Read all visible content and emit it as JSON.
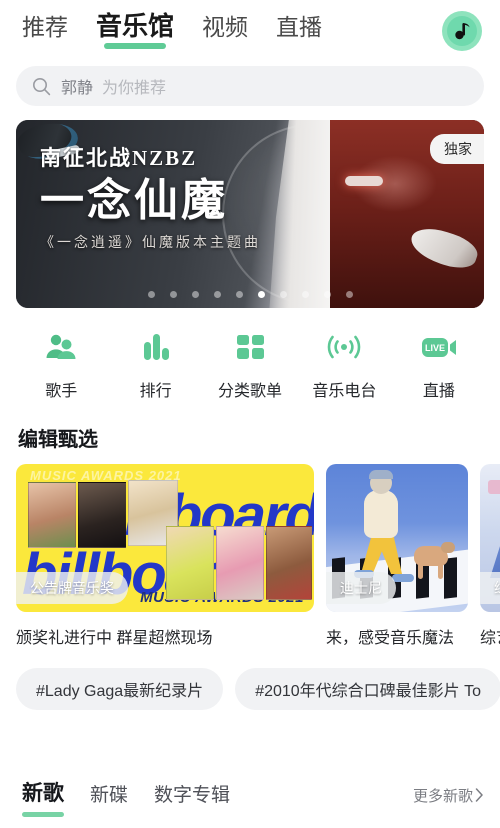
{
  "header": {
    "tabs": [
      {
        "label": "推荐",
        "active": false
      },
      {
        "label": "音乐馆",
        "active": true
      },
      {
        "label": "视频",
        "active": false
      },
      {
        "label": "直播",
        "active": false
      }
    ],
    "avatar_icon": "music-note-icon"
  },
  "search": {
    "icon": "search-icon",
    "keyword": "郭静",
    "placeholder": "为你推荐"
  },
  "banner": {
    "artist": "南征北战NZBZ",
    "title": "一念仙魔",
    "subtitle": "《一念逍遥》仙魔版本主题曲",
    "badge": "独家",
    "dots_total": 10,
    "dots_active_index": 5
  },
  "entries": [
    {
      "label": "歌手",
      "icon": "singers-icon"
    },
    {
      "label": "排行",
      "icon": "ranking-bars-icon"
    },
    {
      "label": "分类歌单",
      "icon": "grid-squares-icon"
    },
    {
      "label": "音乐电台",
      "icon": "radio-waves-icon"
    },
    {
      "label": "直播",
      "icon": "live-video-icon"
    }
  ],
  "editorial": {
    "title": "编辑甄选",
    "cards": [
      {
        "badge": "公告牌音乐奖",
        "caption": "颁奖礼进行中 群星超燃现场",
        "art": "billboard",
        "art_text_top": "MUSIC AWARDS 2021",
        "art_text_bottom": "MUSIC AWARDS 2021",
        "art_word": "billboard"
      },
      {
        "badge": "迪士尼",
        "caption": "来，感受音乐魔法",
        "art": "piano-walk"
      },
      {
        "badge": "综艺",
        "caption": "综艺",
        "art": "variety"
      }
    ]
  },
  "hashtags": [
    "#Lady Gaga最新纪录片",
    "#2010年代综合口碑最佳影片 To"
  ],
  "bottom": {
    "tabs": [
      {
        "label": "新歌",
        "active": true
      },
      {
        "label": "新碟",
        "active": false
      },
      {
        "label": "数字专辑",
        "active": false
      }
    ],
    "more_label": "更多新歌",
    "more_chevron": "chevron-right-icon"
  },
  "colors": {
    "accent_green": "#5fcb96",
    "avatar_green": "#8ee3bd",
    "chip_bg": "#f1f2f4",
    "billboard_yellow": "#fbe83c",
    "billboard_blue": "#2338c8"
  }
}
